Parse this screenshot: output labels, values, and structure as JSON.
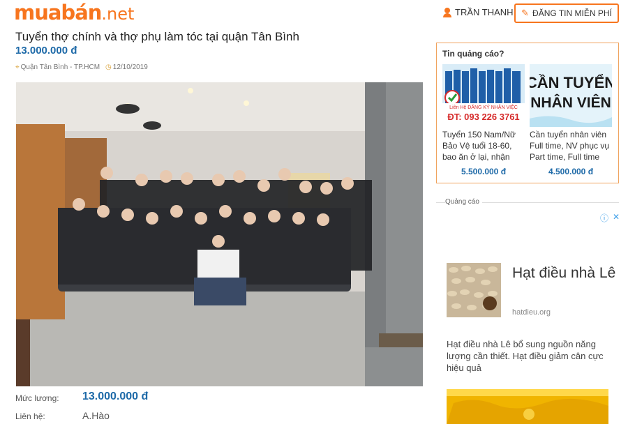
{
  "header": {
    "logo_main": "muabán",
    "logo_tld": ".net",
    "user_name": "TRẦN THANH",
    "post_button": "ĐĂNG TIN MIỄN PHÍ"
  },
  "listing": {
    "title": "Tuyển thợ chính và thợ phụ làm tóc tại quận Tân Bình",
    "price": "13.000.000 đ",
    "location": "Quận Tân Bình - TP.HCM",
    "date": "12/10/2019",
    "salary_label": "Mức lương:",
    "salary_value": "13.000.000 đ",
    "contact_label": "Liên hệ:",
    "contact_value": "A.Hào"
  },
  "ads": {
    "title": "Tin quảng cáo?",
    "cards": [
      {
        "banner_line1": "Liên Hệ ĐĂNG KÝ NHẬN VIỆC",
        "banner_phone": "ĐT: 093 226 3761",
        "text": "Tuyển 150 Nam/Nữ Bảo Vệ tuổi 18-60, bao ăn ở lại, nhận",
        "price": "5.500.000 đ"
      },
      {
        "banner_line1": "CẦN TUYỂN",
        "banner_line2": "NHÂN VIÊN",
        "text": "Cần tuyển nhân viên Full time, NV phục vụ Part time, Full time",
        "price": "4.500.000 đ"
      }
    ]
  },
  "sponsored": {
    "label": "Quảng cáo",
    "title": "Hạt điều nhà Lê",
    "domain": "hatdieu.org",
    "description": "Hạt điều nhà Lê bổ sung nguồn năng lượng cần thiết. Hạt điều giảm cân cực hiệu quả"
  },
  "icons": {
    "user": "user-icon",
    "pencil": "pencil-icon",
    "location": "location-pin-icon",
    "clock": "clock-icon",
    "adchoices": "adchoices-icon",
    "close": "close-icon"
  },
  "colors": {
    "brand": "#f7751e",
    "price": "#1e6aa8",
    "adchoices": "#3a9de8"
  }
}
